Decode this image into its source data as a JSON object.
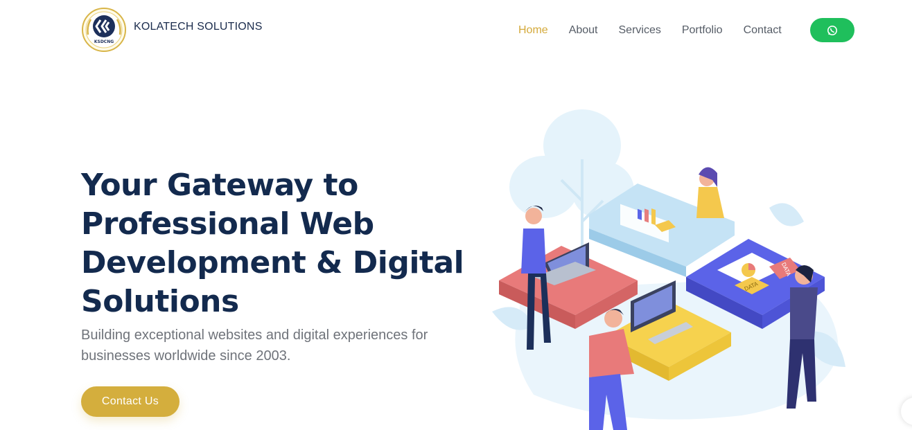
{
  "brand": {
    "name": "KOLATECH SOLUTIONS",
    "logo_text": "KSDCNG"
  },
  "nav": {
    "items": [
      "Home",
      "About",
      "Services",
      "Portfolio",
      "Contact"
    ],
    "active": "Home",
    "whatsapp_icon": "whatsapp-icon"
  },
  "hero": {
    "title_lines": [
      "Your Gateway to",
      "Professional Web",
      "Development & Digital",
      "Solutions"
    ],
    "subtitle_lines": [
      "Building exceptional websites and digital experiences for",
      "businesses worldwide since 2003."
    ],
    "cta_label": "Contact Us"
  },
  "colors": {
    "accent": "#d4ae3d",
    "navy": "#132a4e",
    "whatsapp": "#1fbf5c"
  },
  "illustration": {
    "puzzle_label_1": "DATA",
    "puzzle_label_2": "DATA"
  }
}
